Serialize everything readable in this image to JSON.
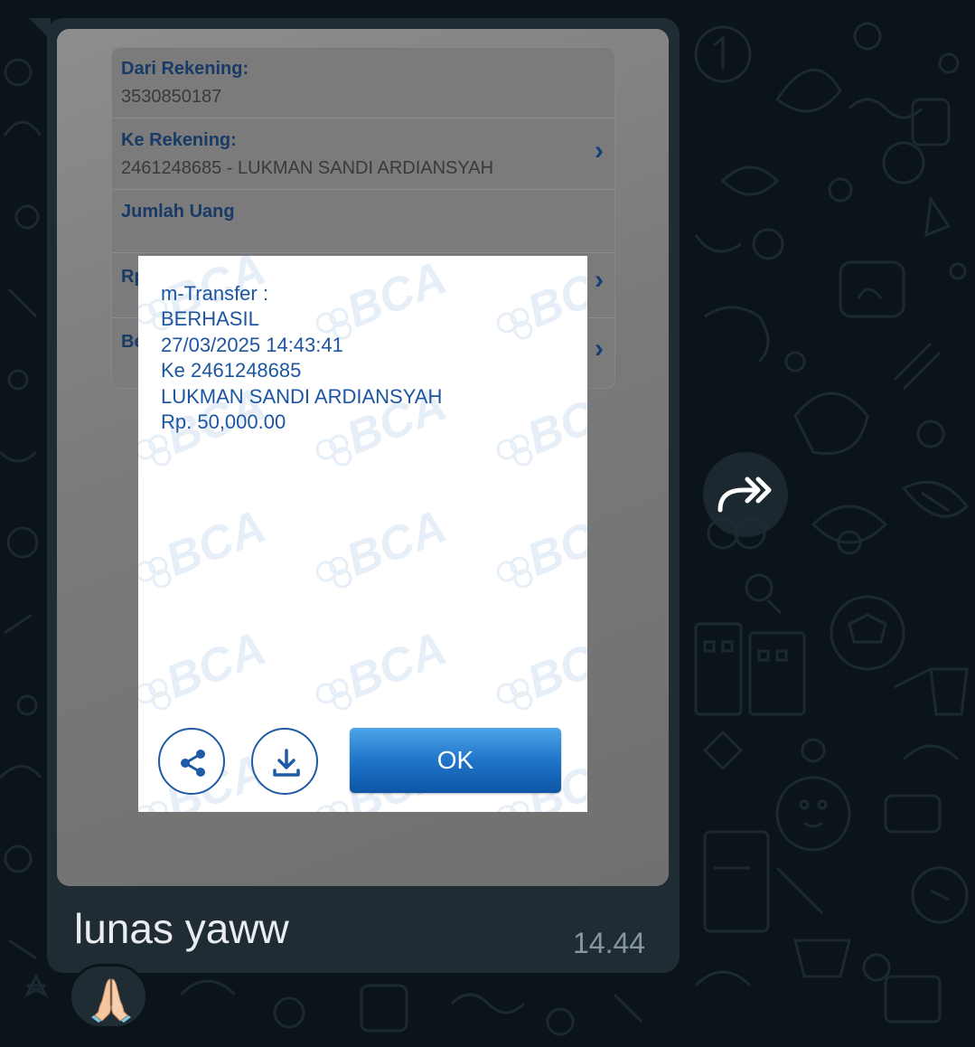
{
  "form": {
    "from_label": "Dari Rekening:",
    "from_value": "3530850187",
    "to_label": "Ke Rekening:",
    "to_value": "2461248685 - LUKMAN SANDI ARDIANSYAH",
    "amount_label": "Jumlah Uang",
    "row4_clipped": "Rp",
    "row5_clipped": "Be"
  },
  "dialog": {
    "lines": [
      "m-Transfer :",
      "BERHASIL",
      "27/03/2025 14:43:41",
      "Ke 2461248685",
      "LUKMAN SANDI ARDIANSYAH",
      "Rp. 50,000.00"
    ],
    "watermark_text": "BCA",
    "ok_label": "OK",
    "share_icon": "share-icon",
    "download_icon": "download-icon"
  },
  "message": {
    "caption": "lunas yaww",
    "time": "14.44",
    "reaction": "🙏"
  },
  "icons": {
    "forward": "forward-icon",
    "chevron": "chevron-right-icon"
  },
  "colors": {
    "chat_bg": "#0b1418",
    "bubble": "#1f2c34",
    "bca_blue": "#1d56a0",
    "ok_button": "#2074c9"
  }
}
